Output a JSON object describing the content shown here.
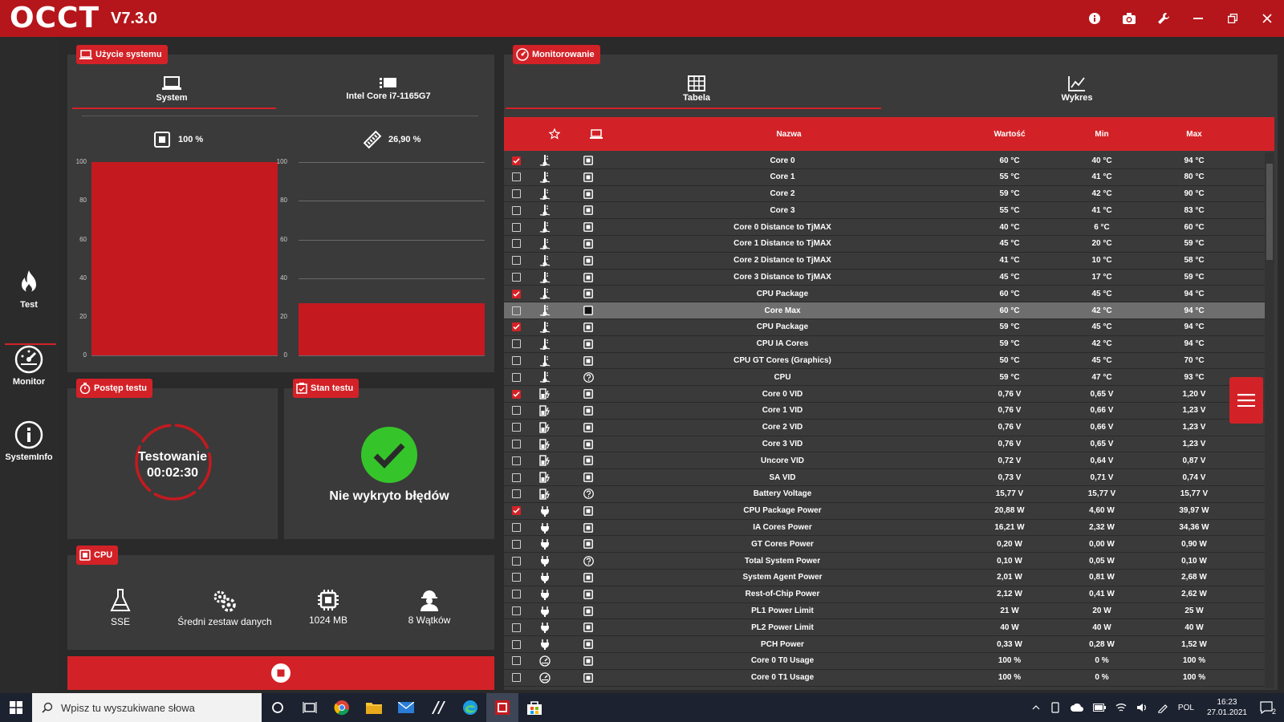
{
  "app": {
    "logo": "OCCT",
    "version": "V7.3.0"
  },
  "sidebar": {
    "items": [
      {
        "label": "Test",
        "icon": "flame-icon"
      },
      {
        "label": "Monitor",
        "icon": "gauge-icon"
      },
      {
        "label": "SystemInfo",
        "icon": "info-icon"
      }
    ]
  },
  "usage": {
    "title": "Użycie systemu",
    "tabs": [
      {
        "label": "System"
      },
      {
        "label": "Intel Core i7-1165G7"
      }
    ],
    "cpu_percent_label": "100 %",
    "ram_percent_label": "26,90 %",
    "axis": [
      "100",
      "80",
      "60",
      "40",
      "20",
      "0"
    ],
    "cpu_usage": 100,
    "ram_usage": 26.9
  },
  "progress": {
    "title": "Postęp testu",
    "status": "Testowanie",
    "time": "00:02:30"
  },
  "state": {
    "title": "Stan testu",
    "message": "Nie wykryto błędów"
  },
  "cpu": {
    "title": "CPU",
    "items": [
      "SSE",
      "Średni zestaw danych",
      "1024 MB",
      "8 Wątków"
    ]
  },
  "monitor": {
    "title": "Monitorowanie",
    "tabs": [
      {
        "label": "Tabela"
      },
      {
        "label": "Wykres"
      }
    ],
    "columns": {
      "name": "Nazwa",
      "value": "Wartość",
      "min": "Min",
      "max": "Max"
    },
    "rows": [
      {
        "checked": true,
        "type": "temp",
        "src": "cpu",
        "name": "Core 0",
        "value": "60 °C",
        "min": "40 °C",
        "max": "94 °C"
      },
      {
        "checked": false,
        "type": "temp",
        "src": "cpu",
        "name": "Core 1",
        "value": "55 °C",
        "min": "41 °C",
        "max": "80 °C"
      },
      {
        "checked": false,
        "type": "temp",
        "src": "cpu",
        "name": "Core 2",
        "value": "59 °C",
        "min": "42 °C",
        "max": "90 °C"
      },
      {
        "checked": false,
        "type": "temp",
        "src": "cpu",
        "name": "Core 3",
        "value": "55 °C",
        "min": "41 °C",
        "max": "83 °C"
      },
      {
        "checked": false,
        "type": "temp",
        "src": "cpu",
        "name": "Core 0 Distance to TjMAX",
        "value": "40 °C",
        "min": "6 °C",
        "max": "60 °C"
      },
      {
        "checked": false,
        "type": "temp",
        "src": "cpu",
        "name": "Core 1 Distance to TjMAX",
        "value": "45 °C",
        "min": "20 °C",
        "max": "59 °C"
      },
      {
        "checked": false,
        "type": "temp",
        "src": "cpu",
        "name": "Core 2 Distance to TjMAX",
        "value": "41 °C",
        "min": "10 °C",
        "max": "58 °C"
      },
      {
        "checked": false,
        "type": "temp",
        "src": "cpu",
        "name": "Core 3 Distance to TjMAX",
        "value": "45 °C",
        "min": "17 °C",
        "max": "59 °C"
      },
      {
        "checked": true,
        "type": "temp",
        "src": "cpu",
        "name": "CPU Package",
        "value": "60 °C",
        "min": "45 °C",
        "max": "94 °C"
      },
      {
        "checked": false,
        "type": "temp",
        "src": "cpu",
        "name": "Core Max",
        "value": "60 °C",
        "min": "42 °C",
        "max": "94 °C",
        "selected": true
      },
      {
        "checked": true,
        "type": "temp",
        "src": "cpu",
        "name": "CPU Package",
        "value": "59 °C",
        "min": "45 °C",
        "max": "94 °C"
      },
      {
        "checked": false,
        "type": "temp",
        "src": "cpu",
        "name": "CPU IA Cores",
        "value": "59 °C",
        "min": "42 °C",
        "max": "94 °C"
      },
      {
        "checked": false,
        "type": "temp",
        "src": "cpu",
        "name": "CPU GT Cores (Graphics)",
        "value": "50 °C",
        "min": "45 °C",
        "max": "70 °C"
      },
      {
        "checked": false,
        "type": "temp",
        "src": "unknown",
        "name": "CPU",
        "value": "59 °C",
        "min": "47 °C",
        "max": "93 °C"
      },
      {
        "checked": true,
        "type": "volt",
        "src": "cpu",
        "name": "Core 0 VID",
        "value": "0,76 V",
        "min": "0,65 V",
        "max": "1,20 V"
      },
      {
        "checked": false,
        "type": "volt",
        "src": "cpu",
        "name": "Core 1 VID",
        "value": "0,76 V",
        "min": "0,66 V",
        "max": "1,23 V"
      },
      {
        "checked": false,
        "type": "volt",
        "src": "cpu",
        "name": "Core 2 VID",
        "value": "0,76 V",
        "min": "0,66 V",
        "max": "1,23 V"
      },
      {
        "checked": false,
        "type": "volt",
        "src": "cpu",
        "name": "Core 3 VID",
        "value": "0,76 V",
        "min": "0,65 V",
        "max": "1,23 V"
      },
      {
        "checked": false,
        "type": "volt",
        "src": "cpu",
        "name": "Uncore VID",
        "value": "0,72 V",
        "min": "0,64 V",
        "max": "0,87 V"
      },
      {
        "checked": false,
        "type": "volt",
        "src": "cpu",
        "name": "SA VID",
        "value": "0,73 V",
        "min": "0,71 V",
        "max": "0,74 V"
      },
      {
        "checked": false,
        "type": "volt",
        "src": "unknown",
        "name": "Battery Voltage",
        "value": "15,77 V",
        "min": "15,77 V",
        "max": "15,77 V"
      },
      {
        "checked": true,
        "type": "power",
        "src": "cpu",
        "name": "CPU Package Power",
        "value": "20,88 W",
        "min": "4,60 W",
        "max": "39,97 W"
      },
      {
        "checked": false,
        "type": "power",
        "src": "cpu",
        "name": "IA Cores Power",
        "value": "16,21 W",
        "min": "2,32 W",
        "max": "34,36 W"
      },
      {
        "checked": false,
        "type": "power",
        "src": "cpu",
        "name": "GT Cores Power",
        "value": "0,20 W",
        "min": "0,00 W",
        "max": "0,90 W"
      },
      {
        "checked": false,
        "type": "power",
        "src": "unknown",
        "name": "Total System Power",
        "value": "0,10 W",
        "min": "0,05 W",
        "max": "0,10 W"
      },
      {
        "checked": false,
        "type": "power",
        "src": "cpu",
        "name": "System Agent Power",
        "value": "2,01 W",
        "min": "0,81 W",
        "max": "2,68 W"
      },
      {
        "checked": false,
        "type": "power",
        "src": "cpu",
        "name": "Rest-of-Chip Power",
        "value": "2,12 W",
        "min": "0,41 W",
        "max": "2,62 W"
      },
      {
        "checked": false,
        "type": "power",
        "src": "cpu",
        "name": "PL1 Power Limit",
        "value": "21 W",
        "min": "20 W",
        "max": "25 W"
      },
      {
        "checked": false,
        "type": "power",
        "src": "cpu",
        "name": "PL2 Power Limit",
        "value": "40 W",
        "min": "40 W",
        "max": "40 W"
      },
      {
        "checked": false,
        "type": "power",
        "src": "cpu",
        "name": "PCH Power",
        "value": "0,33 W",
        "min": "0,28 W",
        "max": "1,52 W"
      },
      {
        "checked": false,
        "type": "usage",
        "src": "cpu",
        "name": "Core 0 T0 Usage",
        "value": "100 %",
        "min": "0 %",
        "max": "100 %"
      },
      {
        "checked": false,
        "type": "usage",
        "src": "cpu",
        "name": "Core 0 T1 Usage",
        "value": "100 %",
        "min": "0 %",
        "max": "100 %"
      }
    ]
  },
  "taskbar": {
    "search_placeholder": "Wpisz tu wyszukiwane słowa",
    "lang": "POL",
    "time": "16:23",
    "date": "27.01.2021",
    "notifications": "2"
  },
  "colors": {
    "accent": "#d32227",
    "titlebar": "#b5161b",
    "panel": "#3a3a3a",
    "ok": "#35c52a"
  }
}
